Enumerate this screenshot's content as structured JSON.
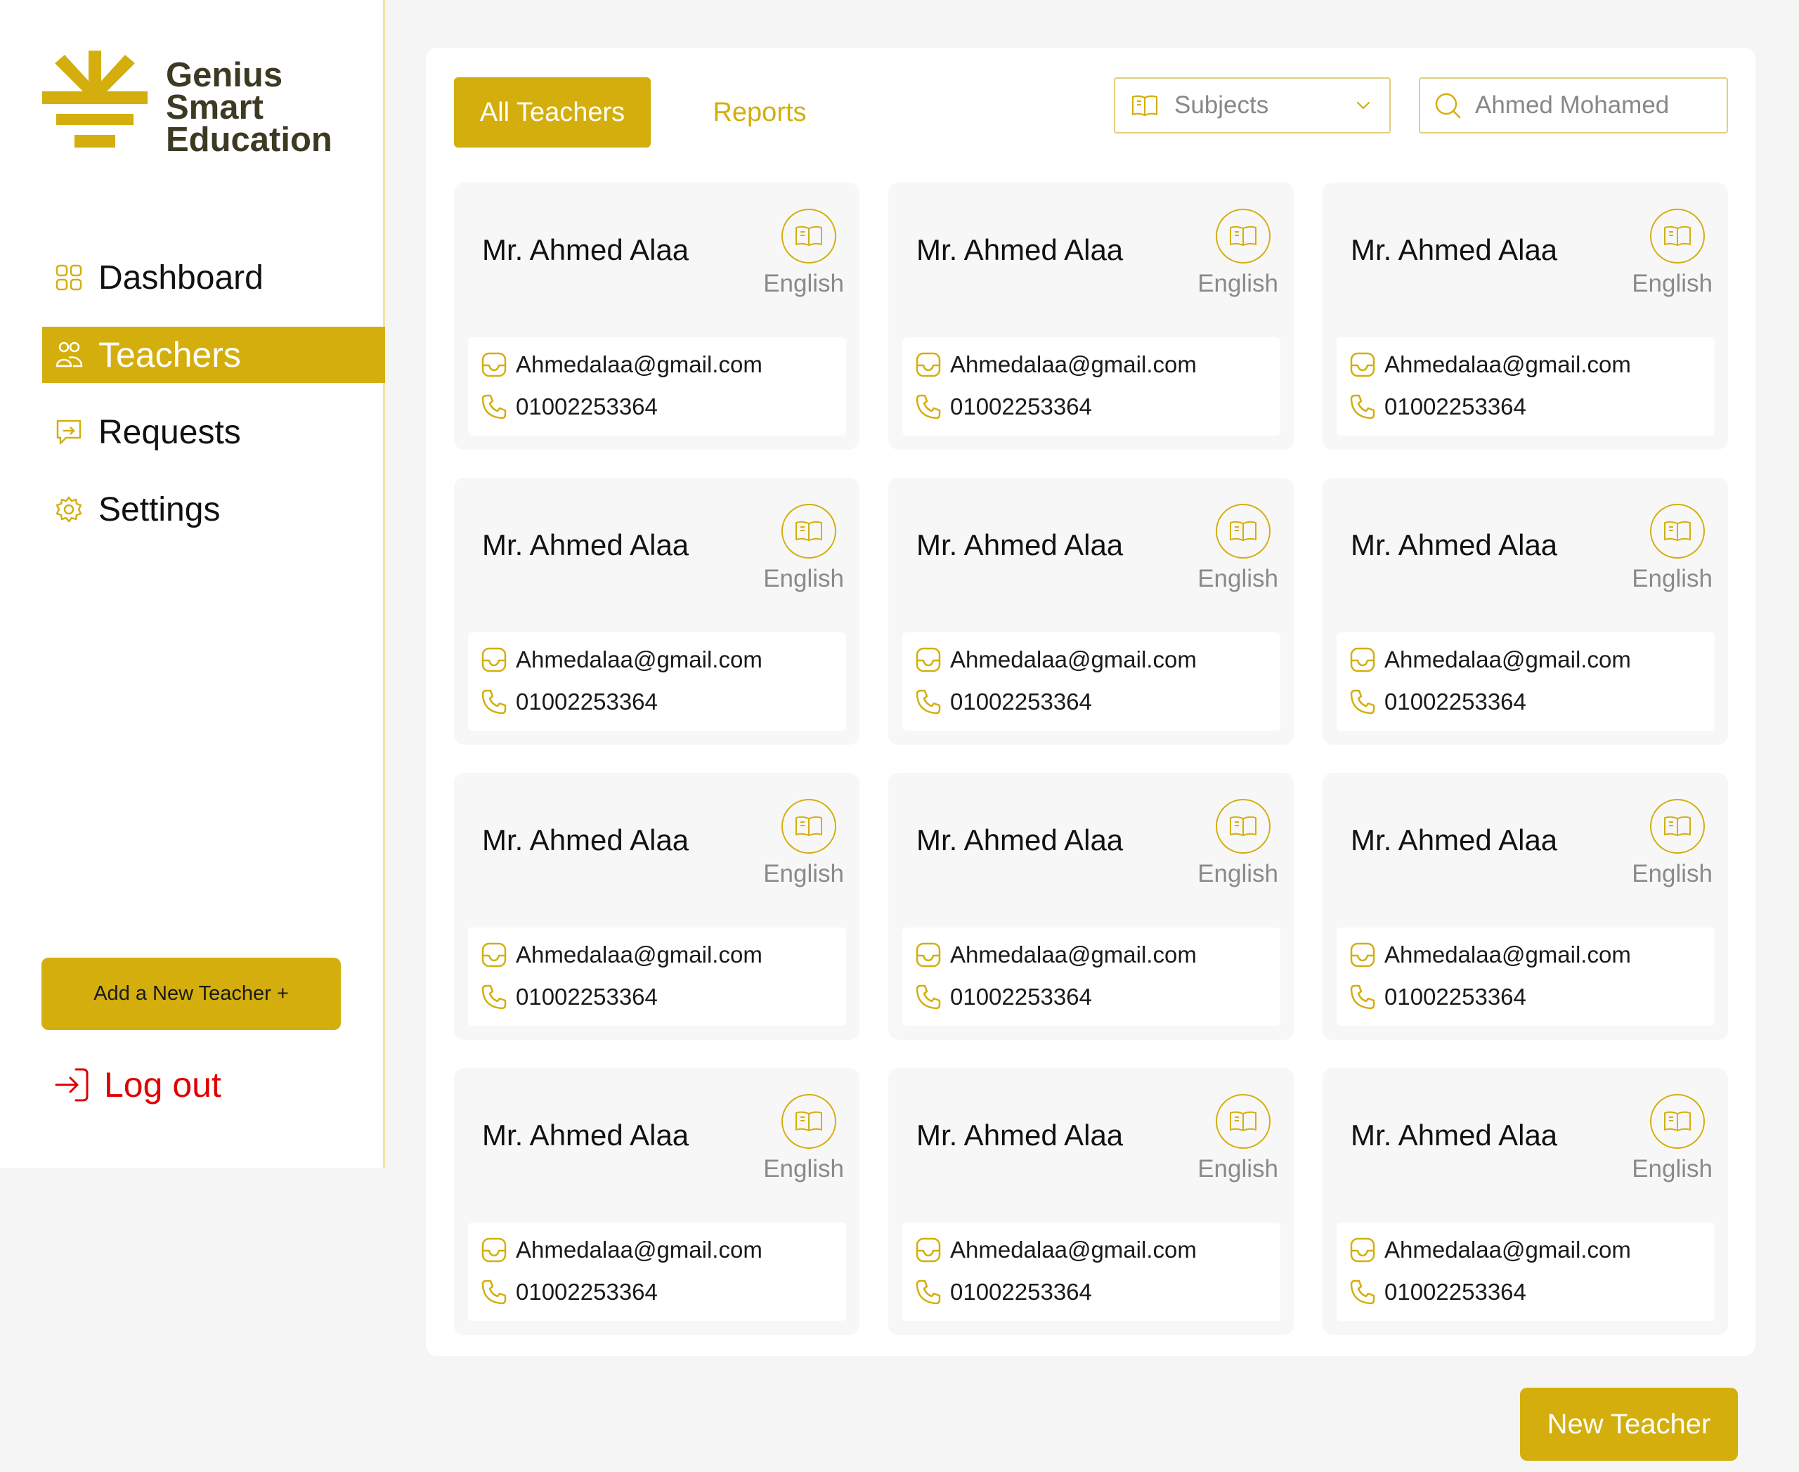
{
  "brand": {
    "name_lines": [
      "Genius",
      "Smart",
      "Education"
    ],
    "color": "#3d3a23",
    "logo_icon": "sunburst-logo-icon"
  },
  "colors": {
    "accent": "#d4ae0c",
    "danger": "#e00000",
    "background": "#f5f5f5"
  },
  "sidebar": {
    "items": [
      {
        "label": "Dashboard",
        "icon": "grid-icon",
        "active": false
      },
      {
        "label": "Teachers",
        "icon": "users-icon",
        "active": true
      },
      {
        "label": "Requests",
        "icon": "chat-icon",
        "active": false
      },
      {
        "label": "Settings",
        "icon": "gear-icon",
        "active": false
      }
    ],
    "add_button_label": "Add a New Teacher +",
    "logout_label": "Log out"
  },
  "tabs": {
    "all_teachers": "All Teachers",
    "reports": "Reports"
  },
  "filters": {
    "subjects_label": "Subjects",
    "search_value": "Ahmed Mohamed"
  },
  "teachers": [
    {
      "name": "Mr. Ahmed Alaa",
      "subject": "English",
      "email": "Ahmedalaa@gmail.com",
      "phone": "01002253364"
    },
    {
      "name": "Mr. Ahmed Alaa",
      "subject": "English",
      "email": "Ahmedalaa@gmail.com",
      "phone": "01002253364"
    },
    {
      "name": "Mr. Ahmed Alaa",
      "subject": "English",
      "email": "Ahmedalaa@gmail.com",
      "phone": "01002253364"
    },
    {
      "name": "Mr. Ahmed Alaa",
      "subject": "English",
      "email": "Ahmedalaa@gmail.com",
      "phone": "01002253364"
    },
    {
      "name": "Mr. Ahmed Alaa",
      "subject": "English",
      "email": "Ahmedalaa@gmail.com",
      "phone": "01002253364"
    },
    {
      "name": "Mr. Ahmed Alaa",
      "subject": "English",
      "email": "Ahmedalaa@gmail.com",
      "phone": "01002253364"
    },
    {
      "name": "Mr. Ahmed Alaa",
      "subject": "English",
      "email": "Ahmedalaa@gmail.com",
      "phone": "01002253364"
    },
    {
      "name": "Mr. Ahmed Alaa",
      "subject": "English",
      "email": "Ahmedalaa@gmail.com",
      "phone": "01002253364"
    },
    {
      "name": "Mr. Ahmed Alaa",
      "subject": "English",
      "email": "Ahmedalaa@gmail.com",
      "phone": "01002253364"
    },
    {
      "name": "Mr. Ahmed Alaa",
      "subject": "English",
      "email": "Ahmedalaa@gmail.com",
      "phone": "01002253364"
    },
    {
      "name": "Mr. Ahmed Alaa",
      "subject": "English",
      "email": "Ahmedalaa@gmail.com",
      "phone": "01002253364"
    },
    {
      "name": "Mr. Ahmed Alaa",
      "subject": "English",
      "email": "Ahmedalaa@gmail.com",
      "phone": "01002253364"
    }
  ],
  "new_teacher_button": "New Teacher"
}
